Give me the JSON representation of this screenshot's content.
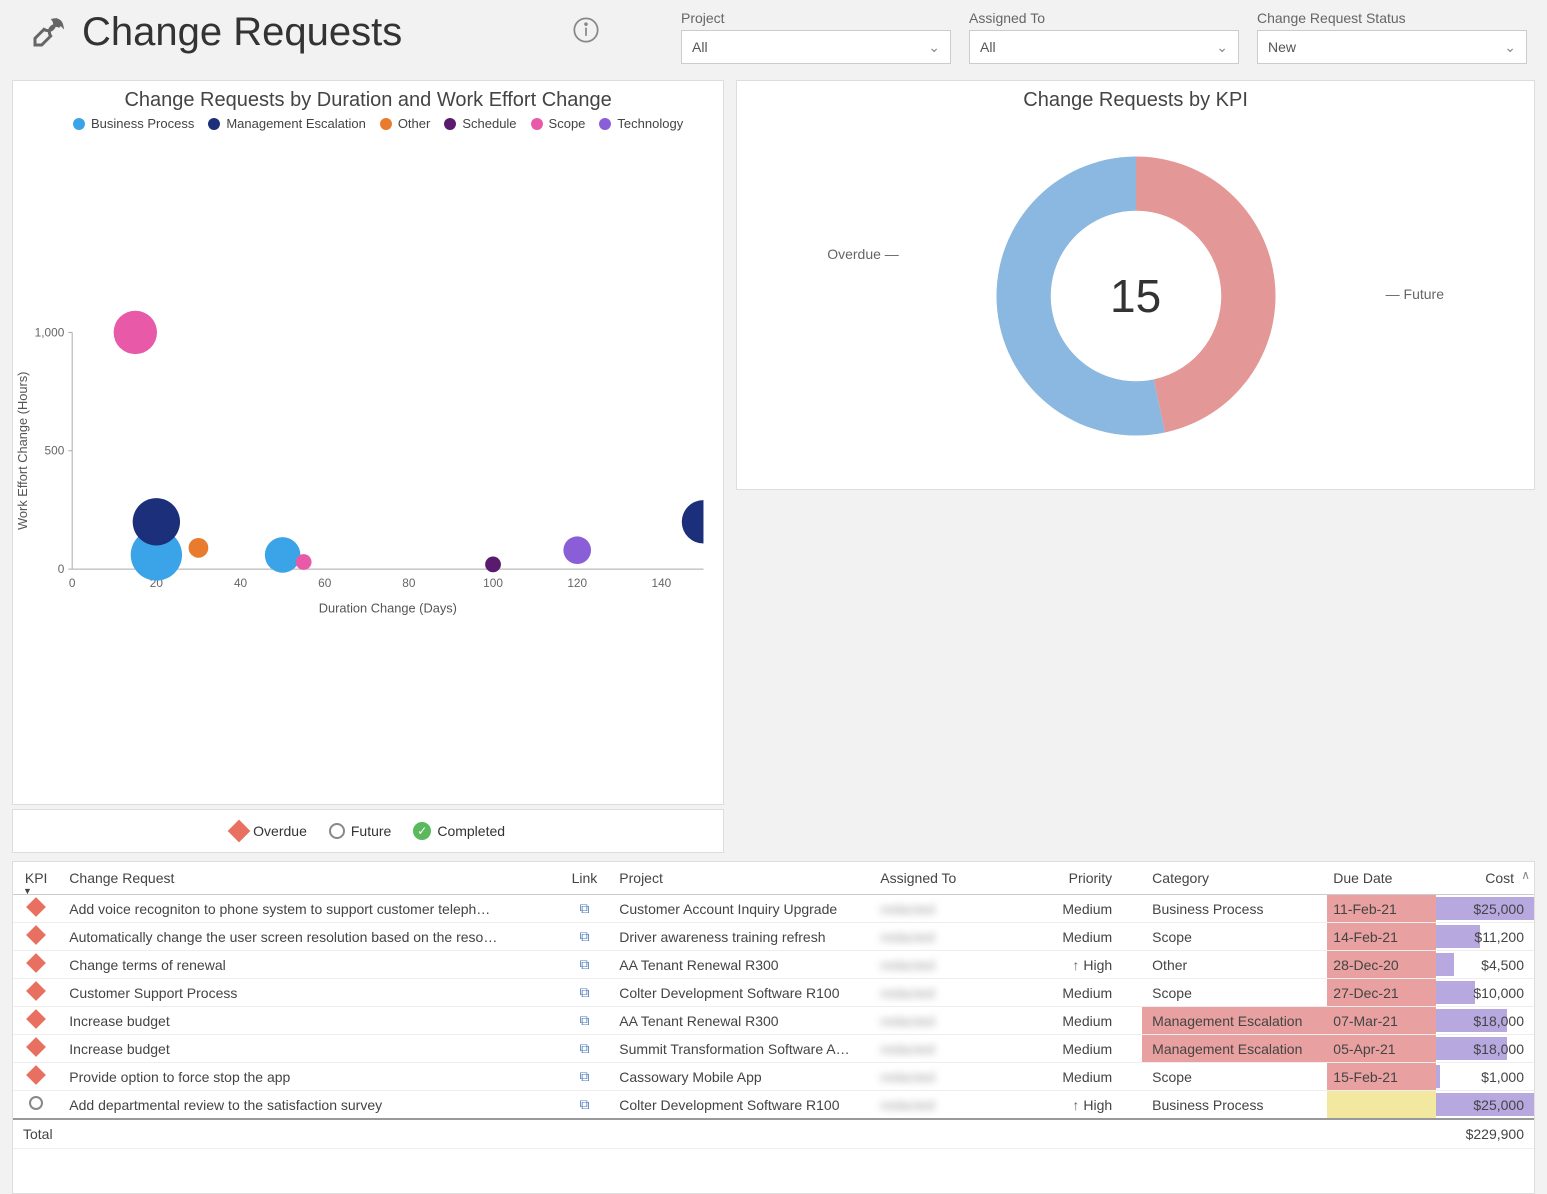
{
  "header": {
    "title": "Change Requests",
    "info_icon": "info"
  },
  "filters": {
    "project": {
      "label": "Project",
      "value": "All"
    },
    "assigned": {
      "label": "Assigned To",
      "value": "All"
    },
    "status": {
      "label": "Change Request Status",
      "value": "New"
    }
  },
  "scatter": {
    "title": "Change Requests by Duration and Work Effort Change",
    "xlabel": "Duration Change (Days)",
    "ylabel": "Work Effort Change (Hours)",
    "legend": [
      {
        "name": "Business Process",
        "color": "#3ba3e8"
      },
      {
        "name": "Management Escalation",
        "color": "#1c2f7a"
      },
      {
        "name": "Other",
        "color": "#e87b2e"
      },
      {
        "name": "Schedule",
        "color": "#5a1a6e"
      },
      {
        "name": "Scope",
        "color": "#e85aa8"
      },
      {
        "name": "Technology",
        "color": "#8a5ed6"
      }
    ]
  },
  "status_legend": {
    "overdue": "Overdue",
    "future": "Future",
    "completed": "Completed"
  },
  "donut": {
    "title": "Change Requests by KPI",
    "center": "15",
    "left_label": "Overdue",
    "right_label": "Future"
  },
  "table": {
    "headers": {
      "kpi": "KPI",
      "cr": "Change Request",
      "link": "Link",
      "project": "Project",
      "assigned": "Assigned To",
      "priority": "Priority",
      "category": "Category",
      "due": "Due Date",
      "cost": "Cost"
    },
    "rows": [
      {
        "kpi": "overdue",
        "cr": "Add voice recogniton to phone system to support customer teleph…",
        "project": "Customer Account Inquiry Upgrade",
        "assigned": "redacted",
        "priority": "Medium",
        "prio_icon": "",
        "category": "Business Process",
        "cat_hl": false,
        "due": "11-Feb-21",
        "due_cls": "due-overdue",
        "cost": "$25,000",
        "bar": 100
      },
      {
        "kpi": "overdue",
        "cr": "Automatically change the user screen resolution based on the reso…",
        "project": "Driver awareness training refresh",
        "assigned": "redacted",
        "priority": "Medium",
        "prio_icon": "",
        "category": "Scope",
        "cat_hl": false,
        "due": "14-Feb-21",
        "due_cls": "due-overdue",
        "cost": "$11,200",
        "bar": 45
      },
      {
        "kpi": "overdue",
        "cr": "Change terms of renewal",
        "project": "AA Tenant Renewal R300",
        "assigned": "redacted",
        "priority": "High",
        "prio_icon": "up",
        "category": "Other",
        "cat_hl": false,
        "due": "28-Dec-20",
        "due_cls": "due-overdue",
        "cost": "$4,500",
        "bar": 18
      },
      {
        "kpi": "overdue",
        "cr": "Customer Support Process",
        "project": "Colter Development Software R100",
        "assigned": "redacted",
        "priority": "Medium",
        "prio_icon": "",
        "category": "Scope",
        "cat_hl": false,
        "due": "27-Dec-21",
        "due_cls": "due-overdue",
        "cost": "$10,000",
        "bar": 40
      },
      {
        "kpi": "overdue",
        "cr": "Increase budget",
        "project": "AA Tenant Renewal R300",
        "assigned": "redacted",
        "priority": "Medium",
        "prio_icon": "",
        "category": "Management Escalation",
        "cat_hl": true,
        "due": "07-Mar-21",
        "due_cls": "due-overdue",
        "cost": "$18,000",
        "bar": 72
      },
      {
        "kpi": "overdue",
        "cr": "Increase budget",
        "project": "Summit Transformation Software A…",
        "assigned": "redacted",
        "priority": "Medium",
        "prio_icon": "",
        "category": "Management Escalation",
        "cat_hl": true,
        "due": "05-Apr-21",
        "due_cls": "due-overdue",
        "cost": "$18,000",
        "bar": 72
      },
      {
        "kpi": "overdue",
        "cr": "Provide option to force stop the app",
        "project": "Cassowary Mobile App",
        "assigned": "redacted",
        "priority": "Medium",
        "prio_icon": "",
        "category": "Scope",
        "cat_hl": false,
        "due": "15-Feb-21",
        "due_cls": "due-overdue",
        "cost": "$1,000",
        "bar": 4
      },
      {
        "kpi": "future",
        "cr": "Add departmental review to the satisfaction survey",
        "project": "Colter Development Software R100",
        "assigned": "redacted",
        "priority": "High",
        "prio_icon": "up",
        "category": "Business Process",
        "cat_hl": false,
        "due": "",
        "due_cls": "due-warn",
        "cost": "$25,000",
        "bar": 100
      }
    ],
    "footer": {
      "label": "Total",
      "cost": "$229,900"
    }
  },
  "chart_data": [
    {
      "type": "scatter",
      "title": "Change Requests by Duration and Work Effort Change",
      "xlabel": "Duration Change (Days)",
      "ylabel": "Work Effort Change (Hours)",
      "xlim": [
        0,
        150
      ],
      "ylim": [
        0,
        1000
      ],
      "series": [
        {
          "name": "Business Process",
          "color": "#3ba3e8",
          "points": [
            {
              "x": 20,
              "y": 60,
              "r": 26
            },
            {
              "x": 50,
              "y": 60,
              "r": 18
            }
          ]
        },
        {
          "name": "Management Escalation",
          "color": "#1c2f7a",
          "points": [
            {
              "x": 20,
              "y": 200,
              "r": 24
            },
            {
              "x": 150,
              "y": 200,
              "r": 22
            }
          ]
        },
        {
          "name": "Other",
          "color": "#e87b2e",
          "points": [
            {
              "x": 30,
              "y": 90,
              "r": 10
            }
          ]
        },
        {
          "name": "Schedule",
          "color": "#5a1a6e",
          "points": [
            {
              "x": 100,
              "y": 20,
              "r": 8
            }
          ]
        },
        {
          "name": "Scope",
          "color": "#e85aa8",
          "points": [
            {
              "x": 15,
              "y": 1000,
              "r": 22
            },
            {
              "x": 55,
              "y": 30,
              "r": 8
            }
          ]
        },
        {
          "name": "Technology",
          "color": "#8a5ed6",
          "points": [
            {
              "x": 120,
              "y": 80,
              "r": 14
            }
          ]
        }
      ]
    },
    {
      "type": "pie",
      "title": "Change Requests by KPI",
      "total": 15,
      "series": [
        {
          "name": "Overdue",
          "value": 7,
          "color": "#e39797"
        },
        {
          "name": "Future",
          "value": 8,
          "color": "#8ab8e0"
        }
      ]
    }
  ]
}
